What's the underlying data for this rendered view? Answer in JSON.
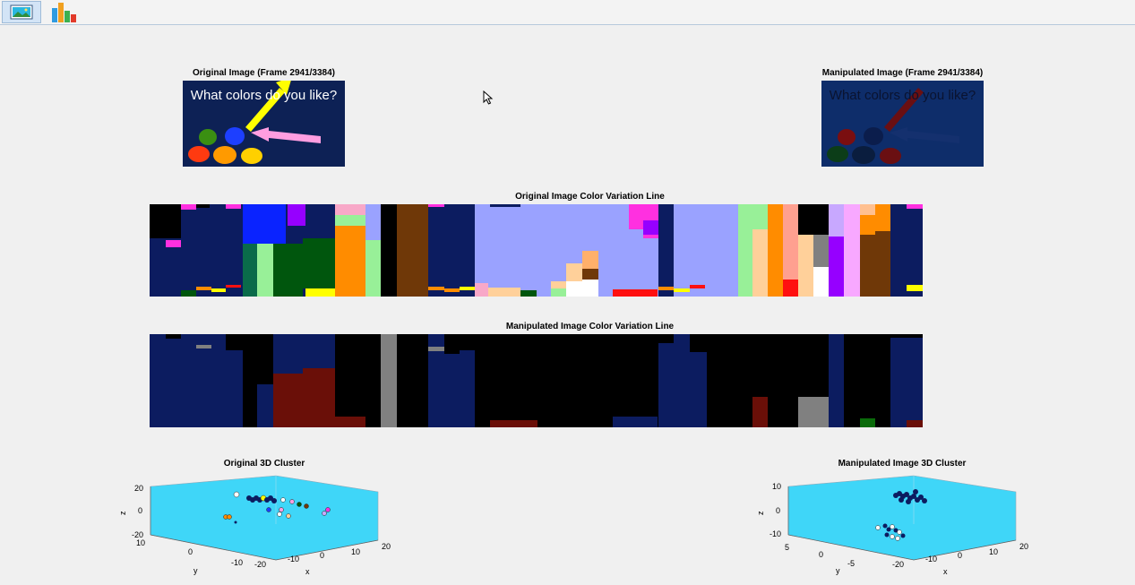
{
  "toolbar": {
    "buttons": [
      {
        "icon": "image-view-icon",
        "selected": true
      },
      {
        "icon": "bar-chart-icon",
        "selected": false
      }
    ]
  },
  "original_image": {
    "title": "Original Image (Frame 2941/3384)",
    "caption": "What colors do you like?"
  },
  "manipulated_image": {
    "title": "Manipulated Image (Frame 2941/3384)",
    "caption": "What colors do you like?"
  },
  "original_line": {
    "title": "Original Image Color Variation Line"
  },
  "manipulated_line": {
    "title": "Manipulated Image Color Variation Line"
  },
  "original_cluster": {
    "title": "Original 3D Cluster",
    "axes": {
      "x_label": "x",
      "y_label": "y",
      "z_label": "z",
      "z_ticks": [
        "20",
        "0",
        "-20"
      ],
      "y_ticks": [
        "10",
        "0",
        "-10"
      ],
      "x_ticks": [
        "-20",
        "-10",
        "0",
        "10",
        "20"
      ]
    }
  },
  "manipulated_cluster": {
    "title": "Manipulated Image 3D Cluster",
    "axes": {
      "x_label": "x",
      "y_label": "y",
      "z_label": "z",
      "z_ticks": [
        "10",
        "0",
        "-10"
      ],
      "y_ticks": [
        "5",
        "0",
        "-5"
      ],
      "x_ticks": [
        "-20",
        "-10",
        "0",
        "10",
        "20"
      ]
    }
  },
  "colors": {
    "axes_face": "#3fd6f8",
    "dark_navy": "#0c1c60",
    "periwinkle": "#9aa2ff"
  }
}
